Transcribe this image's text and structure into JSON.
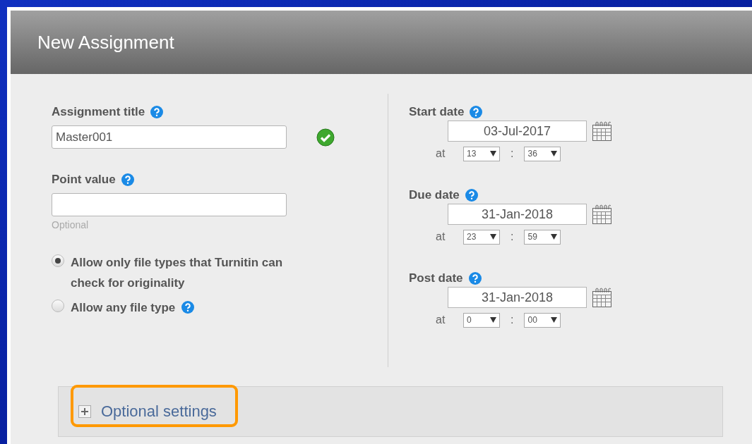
{
  "header": {
    "title": "New Assignment"
  },
  "assignment_title": {
    "label": "Assignment title",
    "value": "Master001",
    "valid": true
  },
  "point_value": {
    "label": "Point value",
    "hint": "Optional"
  },
  "file_types": [
    {
      "label": "Allow only file types that Turnitin can check for originality",
      "selected": true,
      "help": false
    },
    {
      "label": "Allow any file type",
      "selected": false,
      "help": true
    }
  ],
  "dates": [
    {
      "label": "Start date",
      "date": "03-Jul-2017",
      "at": "at",
      "hour": "13",
      "separator": ":",
      "minute": "36"
    },
    {
      "label": "Due date",
      "date": "31-Jan-2018",
      "at": "at",
      "hour": "23",
      "separator": ":",
      "minute": "59"
    },
    {
      "label": "Post date",
      "date": "31-Jan-2018",
      "at": "at",
      "hour": "0",
      "separator": ":",
      "minute": "00"
    }
  ],
  "optional_settings": {
    "label": "Optional settings",
    "expanded": false,
    "highlighted": true
  }
}
